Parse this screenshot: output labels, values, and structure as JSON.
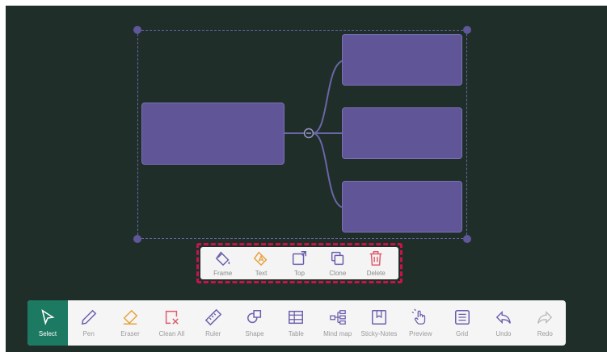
{
  "context_menu": {
    "frame_label": "Frame",
    "text_label": "Text",
    "top_label": "Top",
    "clone_label": "Clone",
    "delete_label": "Delete"
  },
  "toolbar": {
    "select_label": "Select",
    "pen_label": "Pen",
    "eraser_label": "Eraser",
    "clean_all_label": "Clean All",
    "ruler_label": "Ruler",
    "shape_label": "Shape",
    "table_label": "Table",
    "mind_map_label": "Mind map",
    "sticky_notes_label": "Sticky-Notes",
    "preview_label": "Preview",
    "grid_label": "Grid",
    "undo_label": "Undo",
    "redo_label": "Redo"
  },
  "colors": {
    "canvas_bg": "#1f2e28",
    "node_fill": "#5f5597",
    "selection_border": "#6a66a8",
    "context_menu_highlight": "#c8134a",
    "active_tool": "#1d7a62",
    "text_icon": "#e6a23c",
    "eraser_icon": "#e6a23c",
    "delete_icon": "#e05a6a",
    "clean_all_icon": "#e05a6a",
    "default_icon": "#6a5fae",
    "disabled_icon": "#bbbbbb"
  },
  "icons": {
    "frame": "paint-bucket-icon",
    "text": "text-fill-icon",
    "top": "bring-to-top-icon",
    "clone": "clone-icon",
    "delete": "trash-icon",
    "select": "cursor-arrow-icon",
    "pen": "pen-icon",
    "eraser": "eraser-icon",
    "clean_all": "clean-all-icon",
    "ruler": "ruler-icon",
    "shape": "shape-icon",
    "table": "table-icon",
    "mind_map": "mind-map-icon",
    "sticky_notes": "sticky-notes-icon",
    "preview": "hand-pointer-icon",
    "grid": "grid-icon",
    "undo": "undo-icon",
    "redo": "redo-icon"
  }
}
